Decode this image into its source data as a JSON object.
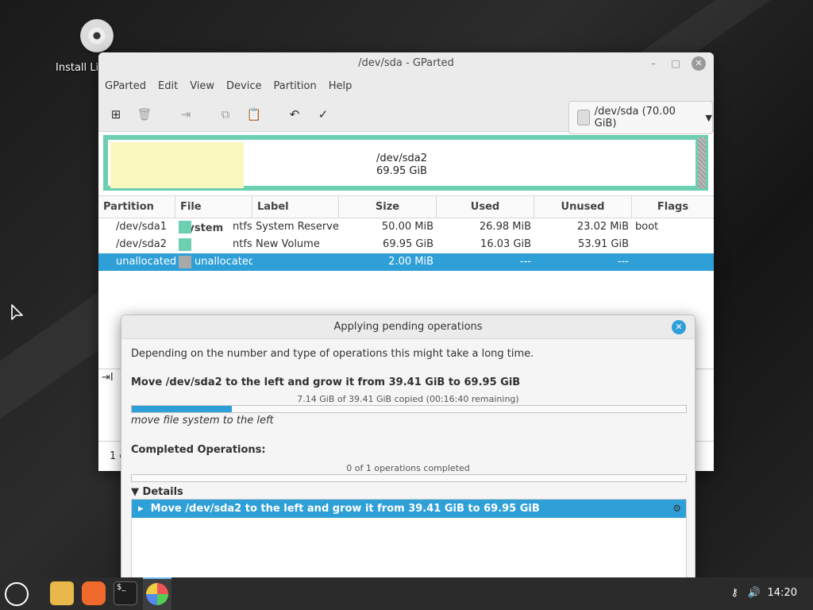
{
  "desktop": {
    "icon_label": "Install Linux Mint"
  },
  "window": {
    "title": "/dev/sda - GParted",
    "menu": [
      "GParted",
      "Edit",
      "View",
      "Device",
      "Partition",
      "Help"
    ],
    "device_selector": "/dev/sda (70.00 GiB)",
    "diskmap": {
      "name": "/dev/sda2",
      "size": "69.95 GiB"
    },
    "columns": [
      "Partition",
      "File System",
      "Label",
      "Size",
      "Used",
      "Unused",
      "Flags"
    ],
    "rows": [
      {
        "partition": "/dev/sda1",
        "fs": "ntfs",
        "label": "System Reserved",
        "size": "50.00 MiB",
        "used": "26.98 MiB",
        "unused": "23.02 MiB",
        "flags": "boot",
        "color": "#6ccfb1"
      },
      {
        "partition": "/dev/sda2",
        "fs": "ntfs",
        "label": "New Volume",
        "size": "69.95 GiB",
        "used": "16.03 GiB",
        "unused": "53.91 GiB",
        "flags": "",
        "color": "#6ccfb1"
      },
      {
        "partition": "unallocated",
        "fs": "unallocated",
        "label": "",
        "size": "2.00 MiB",
        "used": "---",
        "unused": "---",
        "flags": "",
        "color": "#a8a8a8"
      }
    ],
    "status_text": "1 c"
  },
  "dialog": {
    "title": "Applying pending operations",
    "intro": "Depending on the number and type of operations this might take a long time.",
    "operation": "Move /dev/sda2 to the left and grow it from 39.41 GiB to 69.95 GiB",
    "progress_text": "7.14 GiB of 39.41 GiB copied (00:16:40 remaining)",
    "progress_fraction": 0.181,
    "sub_operation": "move file system to the left",
    "completed_label": "Completed Operations:",
    "completed_count": "0 of 1 operations completed",
    "completed_fraction": 0,
    "details_label": "Details",
    "detail_item": "Move /dev/sda2 to the left and grow it from 39.41 GiB to 69.95 GiB"
  },
  "taskbar": {
    "clock": "14:20"
  },
  "colors": {
    "accent": "#2f9fd8",
    "ntfs": "#6ccfb1",
    "used": "#f8f8bf"
  }
}
